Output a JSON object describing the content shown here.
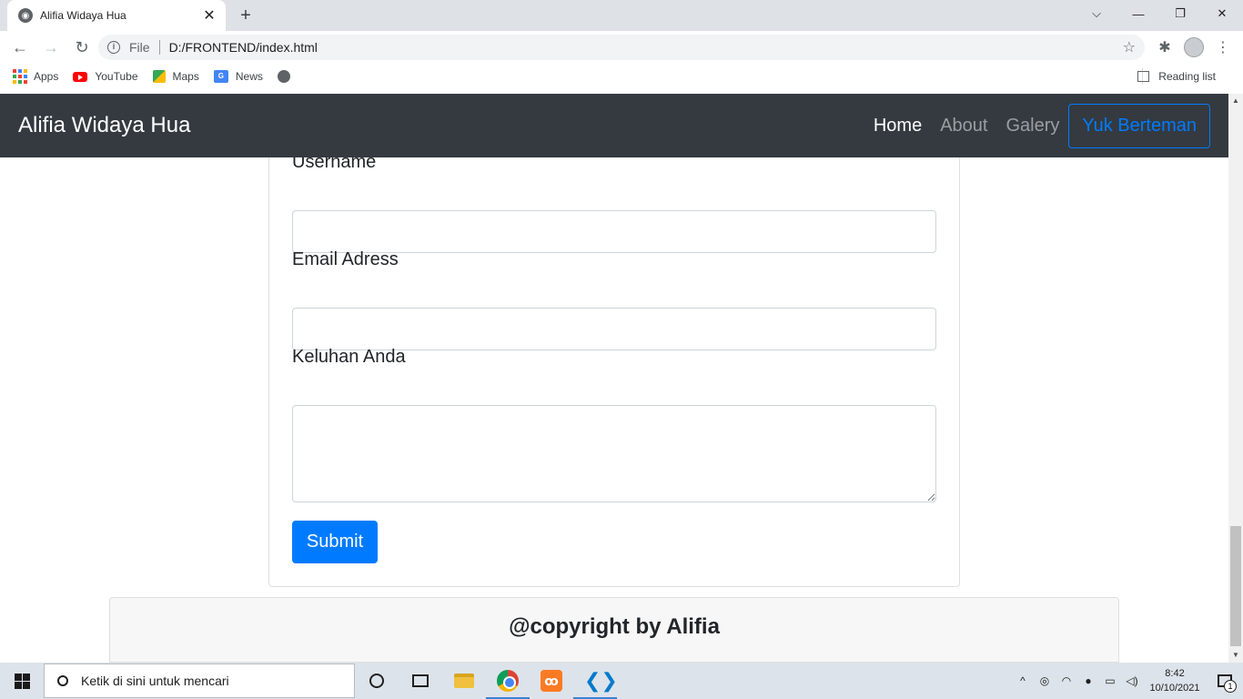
{
  "browser": {
    "tab_title": "Alifia Widaya Hua",
    "tab_close": "✕",
    "new_tab": "+",
    "url_scheme": "File",
    "url": "D:/FRONTEND/index.html",
    "bookmarks": [
      "Apps",
      "YouTube",
      "Maps",
      "News"
    ],
    "reading_list": "Reading list"
  },
  "navbar": {
    "brand": "Alifia Widaya Hua",
    "links": [
      "Home",
      "About",
      "Galery"
    ],
    "cta": "Yuk Berteman"
  },
  "form": {
    "username_label": "Username",
    "email_label": "Email Adress",
    "complaint_label": "Keluhan Anda",
    "submit_label": "Submit"
  },
  "footer": {
    "text": "@copyright by Alifia"
  },
  "taskbar": {
    "search_placeholder": "Ketik di sini untuk mencari",
    "time": "8:42",
    "date": "10/10/2021",
    "notification_count": "1"
  },
  "colors": {
    "navbar_bg": "#343a40",
    "primary": "#007bff"
  }
}
